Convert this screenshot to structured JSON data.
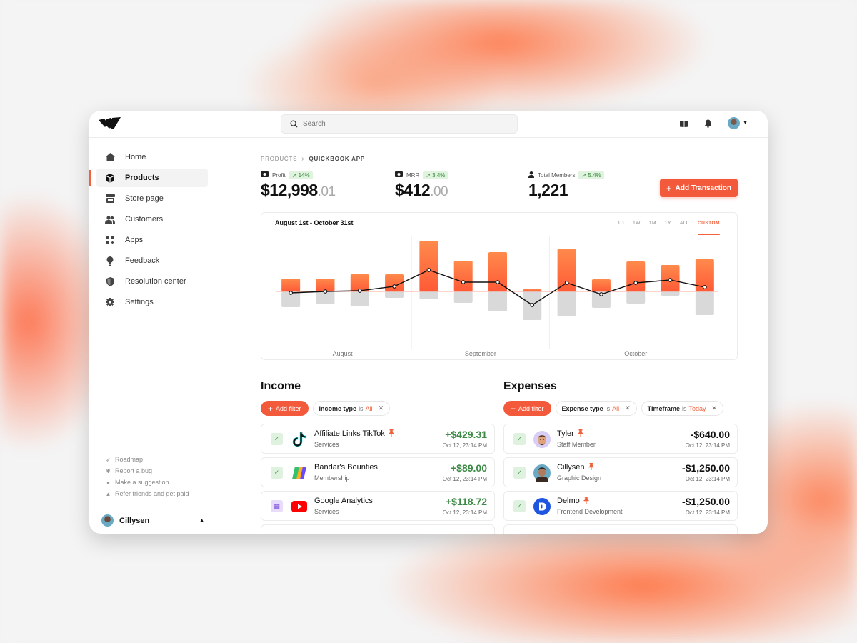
{
  "app": {
    "search_placeholder": "Search"
  },
  "topbar": {
    "icons": [
      "book-icon",
      "bell-icon",
      "user-avatar",
      "caret-down-icon"
    ]
  },
  "sidebar": {
    "items": [
      {
        "label": "Home",
        "icon": "home-icon",
        "active": false
      },
      {
        "label": "Products",
        "icon": "box-icon",
        "active": true
      },
      {
        "label": "Store page",
        "icon": "store-icon",
        "active": false
      },
      {
        "label": "Customers",
        "icon": "users-icon",
        "active": false
      },
      {
        "label": "Apps",
        "icon": "apps-icon",
        "active": false
      },
      {
        "label": "Feedback",
        "icon": "lightbulb-icon",
        "active": false
      },
      {
        "label": "Resolution center",
        "icon": "shield-icon",
        "active": false
      },
      {
        "label": "Settings",
        "icon": "gear-icon",
        "active": false
      }
    ],
    "links": [
      {
        "label": "Roadmap",
        "icon": "rocket-icon"
      },
      {
        "label": "Report a bug",
        "icon": "bug-icon"
      },
      {
        "label": "Make a suggestion",
        "icon": "lightbulb-icon"
      },
      {
        "label": "Refer friends and get paid",
        "icon": "money-bag-icon"
      }
    ],
    "user": {
      "name": "Cillysen"
    }
  },
  "breadcrumb": {
    "parent": "PRODUCTS",
    "current": "QUICKBOOK APP"
  },
  "stats": [
    {
      "label": "Profit",
      "change": "14%",
      "value_main": "$12,998",
      "value_dec": ".01"
    },
    {
      "label": "MRR",
      "change": "3.4%",
      "value_main": "$412",
      "value_dec": ".00"
    },
    {
      "label": "Total Members",
      "change": "5.4%",
      "value_main": "1,221",
      "value_dec": ""
    }
  ],
  "add_transaction_label": "Add Transaction",
  "chart_data": {
    "type": "bar",
    "title": "August 1st - October 31st",
    "ranges": [
      "1D",
      "1W",
      "1M",
      "1Y",
      "ALL",
      "CUSTOM"
    ],
    "active_range": "CUSTOM",
    "months": [
      "August",
      "September",
      "October"
    ],
    "month_breaks_after_index": [
      3,
      7
    ],
    "series": [
      {
        "name": "Income",
        "color": "#ff6a3d",
        "values": [
          18,
          18,
          24,
          24,
          71,
          43,
          55,
          3,
          60,
          17,
          42,
          37,
          45
        ]
      },
      {
        "name": "Expenses",
        "color": "#d9d9d9",
        "values": [
          -22,
          -18,
          -21,
          -9,
          -11,
          -16,
          -28,
          -40,
          -35,
          -23,
          -17,
          -6,
          -33
        ]
      },
      {
        "name": "Net",
        "type": "line",
        "color": "#111111",
        "values": [
          -2,
          0,
          1,
          7,
          30,
          13,
          13,
          -19,
          12,
          -4,
          12,
          16,
          6
        ]
      }
    ],
    "ylim": [
      -50,
      80
    ],
    "grid": false
  },
  "income": {
    "title": "Income",
    "add_filter": "Add filter",
    "filters": [
      {
        "key": "Income type",
        "op": "is",
        "value": "All"
      }
    ],
    "rows": [
      {
        "title": "Affiliate Links TikTok",
        "pinned": true,
        "sub": "Services",
        "amount": "+$429.31",
        "time": "Oct 12, 23:14 PM",
        "status": "check",
        "logo": "tiktok-logo"
      },
      {
        "title": "Bandar's Bounties",
        "pinned": false,
        "sub": "Membership",
        "amount": "+$89.00",
        "time": "Oct 12, 23:14 PM",
        "status": "check",
        "logo": "bandars-bounties-logo"
      },
      {
        "title": "Google Analytics",
        "pinned": false,
        "sub": "Services",
        "amount": "+$118.72",
        "time": "Oct 12, 23:14 PM",
        "status": "calendar",
        "logo": "youtube-logo"
      }
    ]
  },
  "expenses": {
    "title": "Expenses",
    "add_filter": "Add filter",
    "filters": [
      {
        "key": "Expense type",
        "op": "is",
        "value": "All"
      },
      {
        "key": "Timeframe",
        "op": "is",
        "value": "Today"
      }
    ],
    "rows": [
      {
        "title": "Tyler",
        "pinned": true,
        "sub": "Staff Member",
        "amount": "-$640.00",
        "time": "Oct 12, 23:14 PM",
        "status": "check",
        "logo": "tyler-avatar"
      },
      {
        "title": "Cillysen",
        "pinned": true,
        "sub": "Graphic Design",
        "amount": "-$1,250.00",
        "time": "Oct 12, 23:14 PM",
        "status": "check",
        "logo": "cillysen-avatar"
      },
      {
        "title": "Delmo",
        "pinned": true,
        "sub": "Frontend Development",
        "amount": "-$1,250.00",
        "time": "Oct 12, 23:14 PM",
        "status": "check",
        "logo": "delmo-logo"
      }
    ]
  }
}
